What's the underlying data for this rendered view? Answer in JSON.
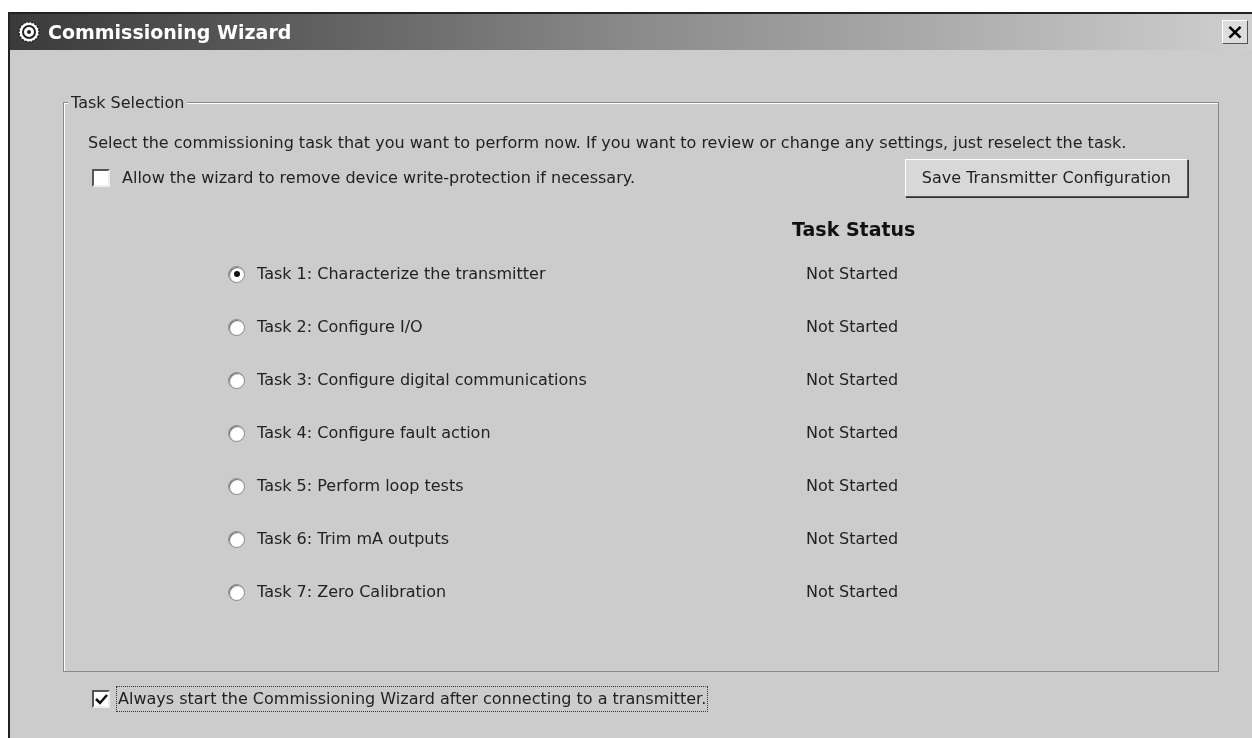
{
  "window": {
    "title": "Commissioning Wizard",
    "close": "×"
  },
  "group": {
    "title": "Task Selection",
    "instructions": "Select the commissioning task that you want to perform now. If you want to review or change any settings, just reselect the task.",
    "write_protect": {
      "label": "Allow the wizard to remove device write-protection if necessary.",
      "checked": false
    },
    "save_button": "Save Transmitter Configuration",
    "status_heading": "Task Status",
    "tasks": [
      {
        "label": "Task 1: Characterize the transmitter",
        "status": "Not Started",
        "selected": true
      },
      {
        "label": "Task 2: Configure I/O",
        "status": "Not Started",
        "selected": false
      },
      {
        "label": "Task 3: Configure digital communications",
        "status": "Not Started",
        "selected": false
      },
      {
        "label": "Task 4: Configure fault action",
        "status": "Not Started",
        "selected": false
      },
      {
        "label": "Task 5: Perform loop tests",
        "status": "Not Started",
        "selected": false
      },
      {
        "label": "Task 6: Trim mA outputs",
        "status": "Not Started",
        "selected": false
      },
      {
        "label": "Task 7: Zero Calibration",
        "status": "Not Started",
        "selected": false
      }
    ]
  },
  "always_start": {
    "label": "Always start the Commissioning Wizard after connecting to a transmitter.",
    "checked": true
  }
}
